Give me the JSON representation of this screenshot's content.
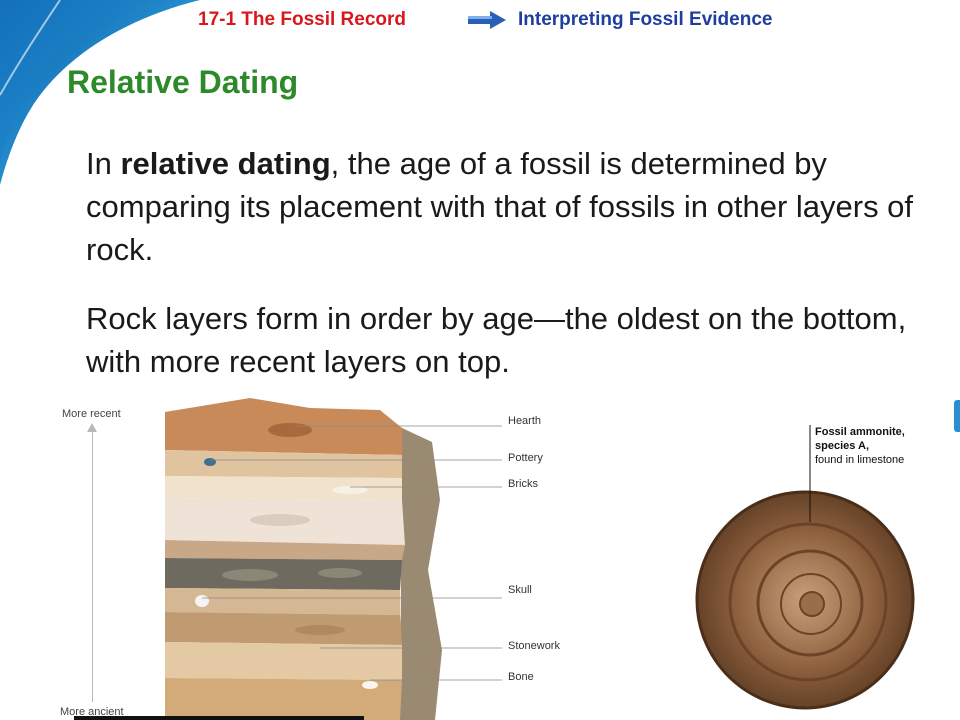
{
  "header": {
    "section": "17-1 The Fossil Record",
    "topic": "Interpreting Fossil Evidence"
  },
  "title": "Relative Dating",
  "paragraphs": {
    "p1": {
      "prefix": "In ",
      "term": "relative dating",
      "rest": ", the age of a fossil is determined by comparing its placement with that of fossils in other layers of rock."
    },
    "p2": "Rock layers form in order by age—the oldest on the bottom, with more recent layers on top."
  },
  "strata_figure": {
    "axis_top": "More recent",
    "axis_bottom": "More ancient",
    "layers": {
      "hearth": "Hearth",
      "pottery": "Pottery",
      "bricks": "Bricks",
      "skull": "Skull",
      "stonework": "Stonework",
      "bone": "Bone"
    }
  },
  "ammonite_figure": {
    "caption_line1": "Fossil ammonite,",
    "caption_line2": "species A,",
    "caption_line3": "found in limestone"
  },
  "colors": {
    "header_section": "#d8161c",
    "header_topic": "#1f3fa0",
    "title": "#2d8a2a",
    "swoosh": "#1a7fc8"
  }
}
